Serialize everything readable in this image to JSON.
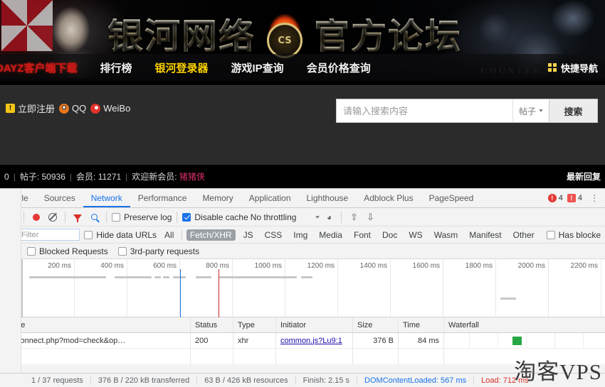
{
  "forum": {
    "banner": {
      "title_left": "银河网络",
      "title_right": "官方论坛",
      "cs_emblem": "CS",
      "cs_logo": "COUNTER STRIKE"
    },
    "nav": [
      {
        "label": "DAYZ客户端下载",
        "style": "red"
      },
      {
        "label": "排行榜",
        "style": "normal"
      },
      {
        "label": "银河登录器",
        "style": "active"
      },
      {
        "label": "游戏IP查询",
        "style": "normal"
      },
      {
        "label": "会员价格查询",
        "style": "normal"
      }
    ],
    "nav_right": {
      "icon": "grid-icon",
      "label": "快捷导航"
    },
    "userbar": [
      {
        "icon": "warning-icon",
        "label": "立即注册"
      },
      {
        "icon": "qq-icon",
        "label": "QQ"
      },
      {
        "icon": "weibo-icon",
        "label": "WeiBo"
      }
    ],
    "search": {
      "placeholder": "请输入搜索内容",
      "scope": "帖子",
      "button": "搜索"
    },
    "stats": {
      "leading": "0",
      "posts_label": "帖子:",
      "posts_value": "50936",
      "members_label": "会员:",
      "members_value": "11271",
      "welcome_label": "欢迎新会员:",
      "welcome_value": "猪猪侠",
      "right": "最新回复"
    }
  },
  "devtools": {
    "tabs": [
      {
        "label": "nsole",
        "active": false
      },
      {
        "label": "Sources",
        "active": false
      },
      {
        "label": "Network",
        "active": true
      },
      {
        "label": "Performance",
        "active": false
      },
      {
        "label": "Memory",
        "active": false
      },
      {
        "label": "Application",
        "active": false
      },
      {
        "label": "Lighthouse",
        "active": false
      },
      {
        "label": "Adblock Plus",
        "active": false
      },
      {
        "label": "PageSpeed",
        "active": false
      }
    ],
    "badges": {
      "errors": "4",
      "warnings": "4"
    },
    "toolbar": {
      "close": "×",
      "record": "record-button",
      "clear": "clear-button",
      "filter": "filter-button",
      "search": "search-button",
      "preserve_log": "Preserve log",
      "preserve_log_checked": false,
      "disable_cache": "Disable cache",
      "disable_cache_checked": true,
      "throttling": "No throttling",
      "settings": "network-conditions-icon",
      "import": "import-har-icon",
      "export": "export-har-icon"
    },
    "filterbar": {
      "filter_placeholder": "Filter",
      "hide_data_urls": "Hide data URLs",
      "types": [
        {
          "label": "All",
          "active": false
        },
        {
          "label": "Fetch/XHR",
          "active": true
        },
        {
          "label": "JS",
          "active": false
        },
        {
          "label": "CSS",
          "active": false
        },
        {
          "label": "Img",
          "active": false
        },
        {
          "label": "Media",
          "active": false
        },
        {
          "label": "Font",
          "active": false
        },
        {
          "label": "Doc",
          "active": false
        },
        {
          "label": "WS",
          "active": false
        },
        {
          "label": "Wasm",
          "active": false
        },
        {
          "label": "Manifest",
          "active": false
        },
        {
          "label": "Other",
          "active": false
        }
      ],
      "has_blocked": "Has blocke",
      "blocked_requests": "Blocked Requests",
      "third_party": "3rd-party requests"
    },
    "overview": {
      "ticks": [
        "200 ms",
        "400 ms",
        "600 ms",
        "800 ms",
        "1000 ms",
        "1200 ms",
        "1400 ms",
        "1600 ms",
        "1800 ms",
        "2000 ms",
        "2200 ms"
      ]
    },
    "table": {
      "columns": [
        "Name",
        "Status",
        "Type",
        "Initiator",
        "Size",
        "Time",
        "Waterfall"
      ],
      "rows": [
        {
          "name": "connect.php?mod=check&op…",
          "status": "200",
          "type": "xhr",
          "initiator": "common.js?Lu9:1",
          "size": "376 B",
          "time": "84 ms"
        }
      ]
    },
    "status": [
      {
        "text": "1 / 37 requests",
        "color": "normal"
      },
      {
        "text": "376 B / 220 kB transferred",
        "color": "normal"
      },
      {
        "text": "63 B / 426 kB resources",
        "color": "normal"
      },
      {
        "text": "Finish: 2.15 s",
        "color": "normal"
      },
      {
        "text": "DOMContentLoaded: 567 ms",
        "color": "blue"
      },
      {
        "text": "Load: 712 ms",
        "color": "red"
      }
    ]
  },
  "watermark": "淘客VPS"
}
